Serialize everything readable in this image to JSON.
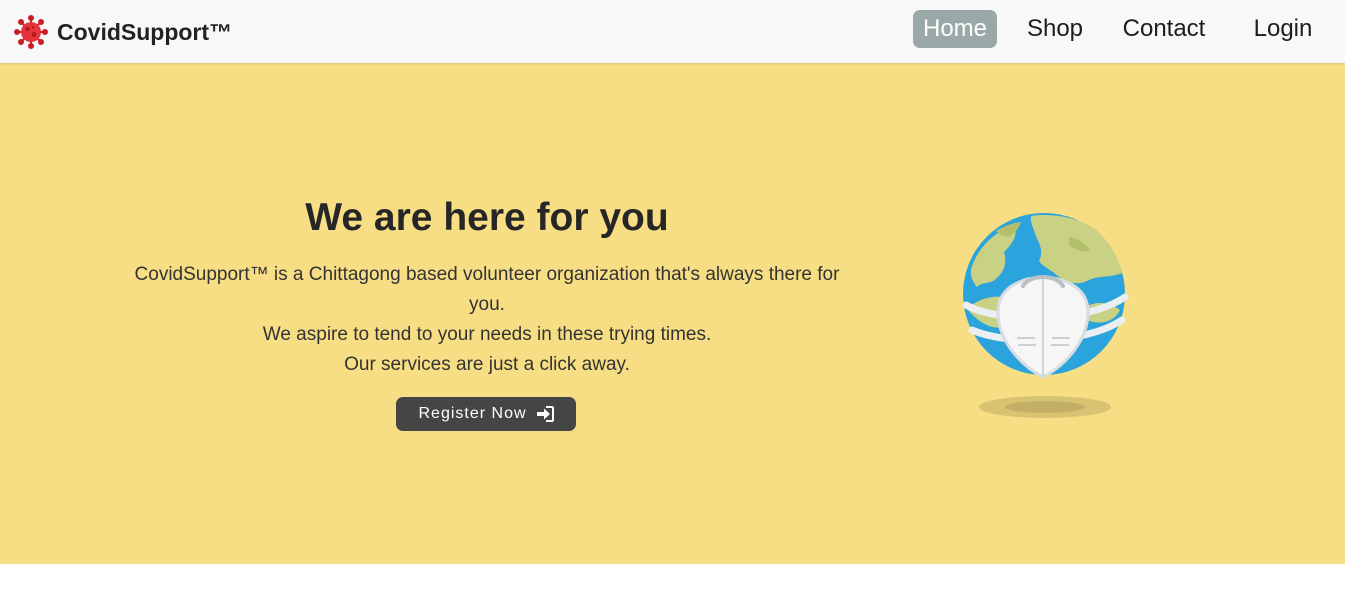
{
  "navbar": {
    "brand": "CovidSupport™",
    "brand_icon": "virus-icon",
    "links": [
      {
        "label": "Home",
        "active": true
      },
      {
        "label": "Shop",
        "active": false
      },
      {
        "label": "Contact",
        "active": false
      },
      {
        "label": "Login",
        "active": false
      }
    ],
    "active_color": "#9aa9a7"
  },
  "hero": {
    "title": "We are here for you",
    "lines": [
      "CovidSupport™ is a Chittagong based volunteer organization that's always there for you.",
      "We aspire to tend to your needs in these trying times.",
      "Our services are just a click away."
    ],
    "button_label": "Register Now",
    "button_icon": "sign-in-icon",
    "illustration": "masked-globe-icon",
    "background_color": "#f7de84"
  }
}
